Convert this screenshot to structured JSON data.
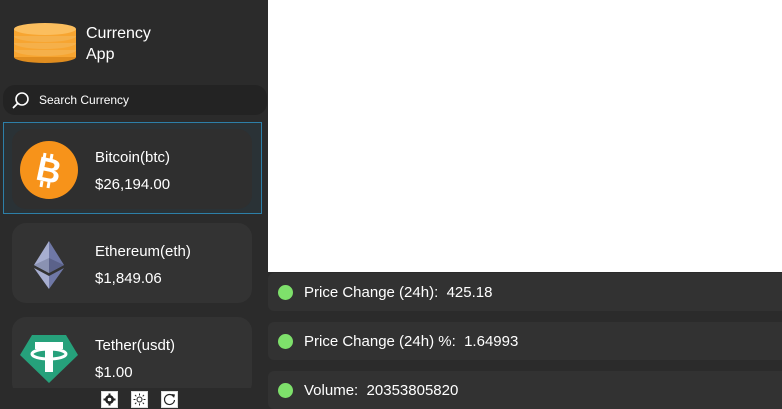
{
  "app": {
    "title_line1": "Currency",
    "title_line2": "App",
    "logo_icon": "coin-stack-icon",
    "logo_color": "#f7a531"
  },
  "search": {
    "placeholder": "Search Currency",
    "value": "",
    "icon": "search-icon"
  },
  "coins": [
    {
      "name": "Bitcoin(btc)",
      "price": "$26,194.00",
      "icon": "bitcoin-icon",
      "color": "#f7931a",
      "selected": true
    },
    {
      "name": "Ethereum(eth)",
      "price": "$1,849.06",
      "icon": "ethereum-icon",
      "color": "#8a92b2",
      "selected": false
    },
    {
      "name": "Tether(usdt)",
      "price": "$1.00",
      "icon": "tether-icon",
      "color": "#26a17b",
      "selected": false
    }
  ],
  "toolbar": {
    "buttons": [
      "settings-icon",
      "brightness-icon",
      "refresh-icon"
    ]
  },
  "stats": [
    {
      "label": "Price Change (24h):",
      "value": "425.18"
    },
    {
      "label": "Price Change (24h) %:",
      "value": "1.64993"
    },
    {
      "label": "Volume:",
      "value": "20353805820"
    }
  ],
  "status_color": "#7ee06b"
}
